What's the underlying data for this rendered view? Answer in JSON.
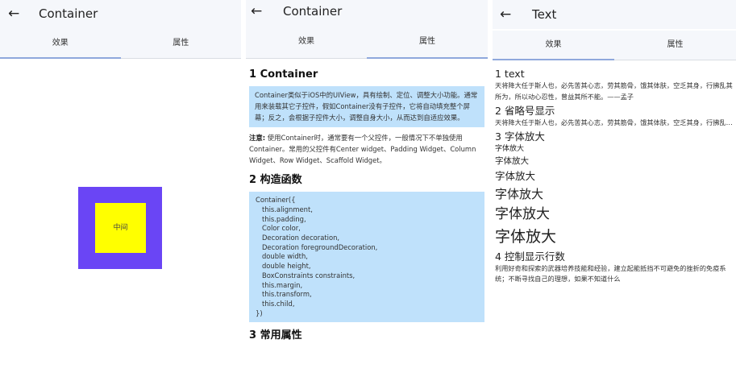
{
  "panel1": {
    "title": "Container",
    "tabs": [
      "效果",
      "属性"
    ],
    "inner_label": "中间",
    "colors": {
      "outer": "#6a45f5",
      "inner": "#ffff00"
    }
  },
  "panel2": {
    "title": "Container",
    "tabs": [
      "效果",
      "属性"
    ],
    "h1": "1 Container",
    "desc": "Container类似于iOS中的UIView，具有绘制、定位、调整大小功能。通常用来装载其它子控件，假如Container没有子控件，它将自动填充整个屏幕；反之，会根据子控件大小，调整自身大小，从而达到自适应效果。",
    "note_label": "注意:",
    "note_text": " 使用Container时，通常要有一个父控件，一般情况下不单独使用Container。常用的父控件有Center widget、Padding Widget、Column Widget、Row Widget、Scaffold Widget。",
    "h2": "2 构造函数",
    "code": "Container({\n   this.alignment,\n   this.padding,\n   Color color,\n   Decoration decoration,\n   Decoration foregroundDecoration,\n   double width,\n   double height,\n   BoxConstraints constraints,\n   this.margin,\n   this.transform,\n   this.child,\n})",
    "h3": "3 常用属性"
  },
  "panel3": {
    "title": "Text",
    "tabs": [
      "效果",
      "属性"
    ],
    "s1_title": "1 text",
    "s1_text": "天将降大任于斯人也，必先苦其心志，劳其筋骨，饿其体肤，空乏其身，行拂乱其所为，所以动心忍性，曾益其所不能。——孟子",
    "s2_title": "2 省略号显示",
    "s2_text": "天将降大任于斯人也，必先苦其心志，劳其筋骨，饿其体肤，空乏其身，行拂乱其所为，所以动心忍性，曾益其所不能。",
    "s3_title": "3 字体放大",
    "scaled": [
      "字体放大",
      "字体放大",
      "字体放大",
      "字体放大",
      "字体放大",
      "字体放大"
    ],
    "s4_title": "4 控制显示行数",
    "s4_text": "利用好奇和探索的武器培养技能和经验，建立起能抵挡不可避免的挫折的免疫系统；不断寻找自己的理想，如果不知道什么"
  }
}
